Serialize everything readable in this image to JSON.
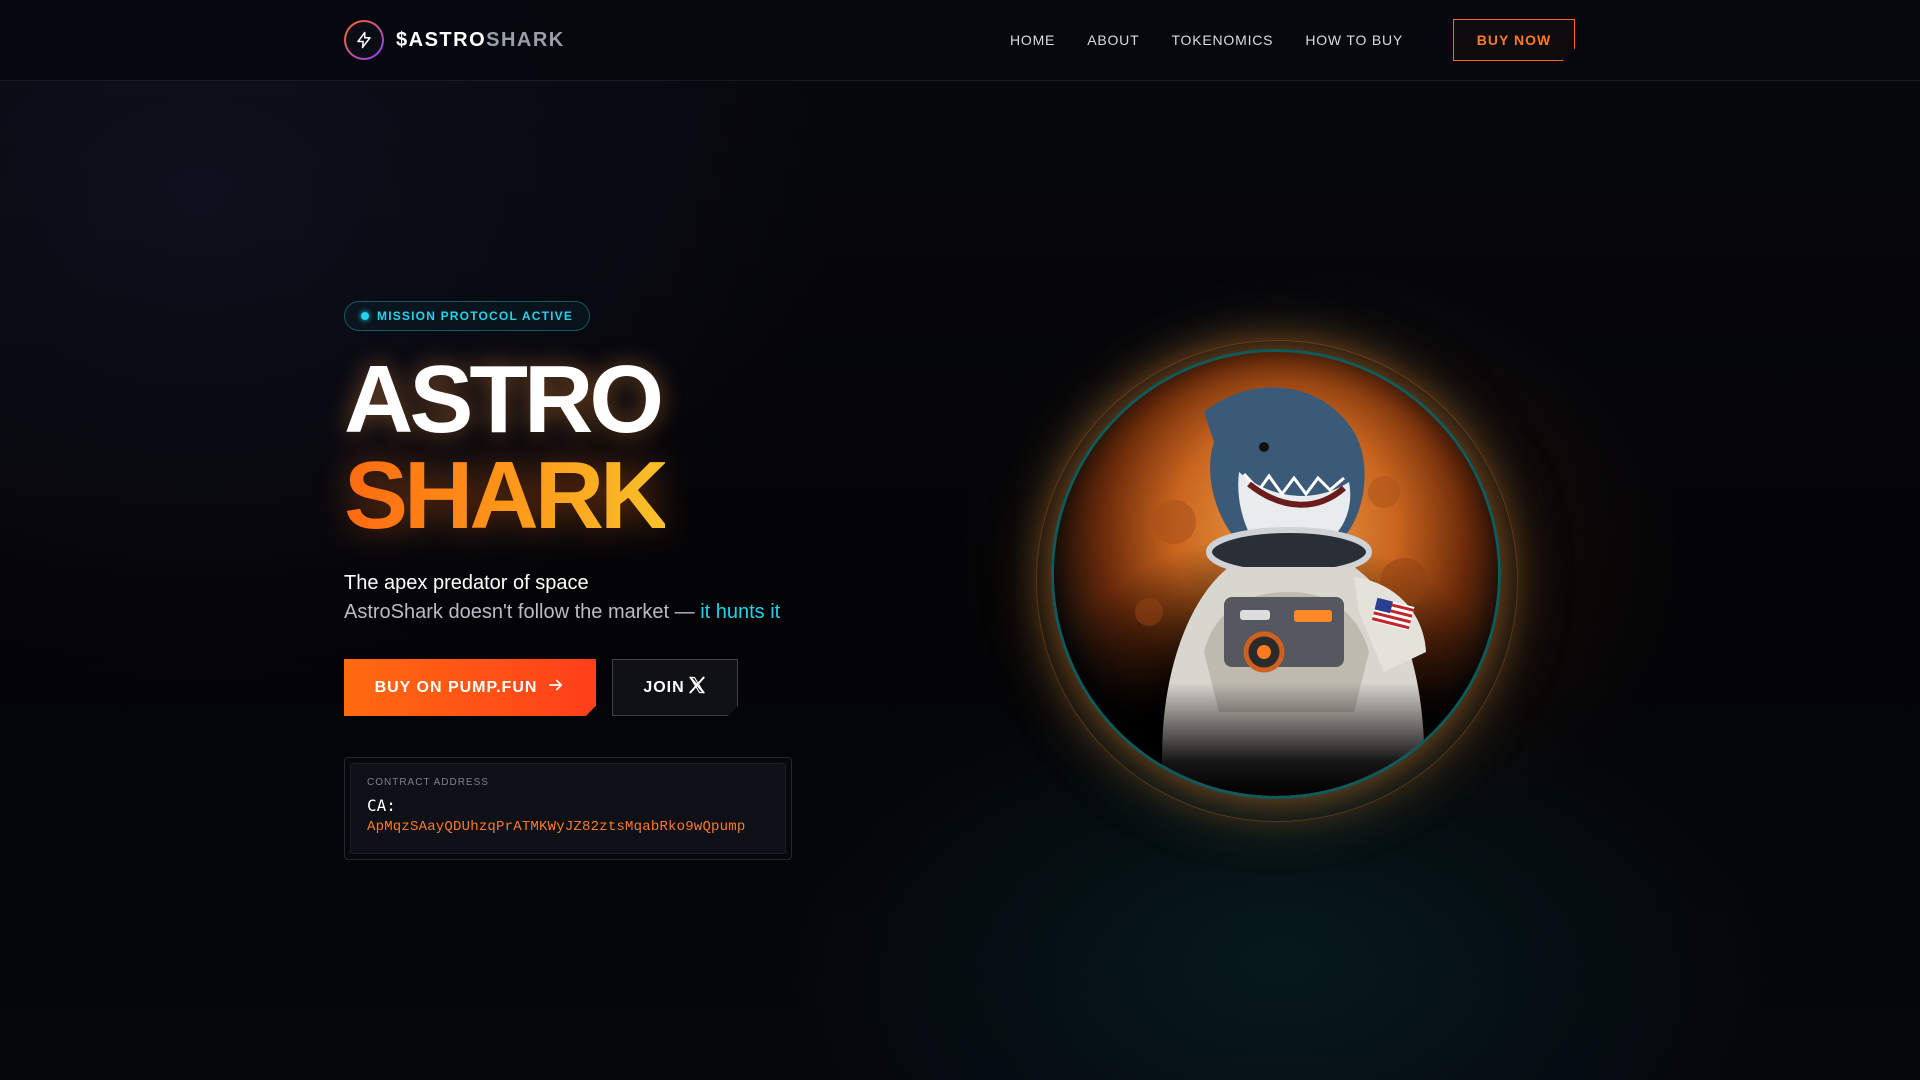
{
  "brand": {
    "ticker_primary": "$ASTRO",
    "ticker_secondary": "SHARK",
    "logo_icon": "lightning-bolt-icon"
  },
  "nav": {
    "items": [
      {
        "label": "HOME"
      },
      {
        "label": "ABOUT"
      },
      {
        "label": "TOKENOMICS"
      },
      {
        "label": "HOW TO BUY"
      }
    ],
    "cta_label": "BUY NOW"
  },
  "hero": {
    "badge": "MISSION PROTOCOL ACTIVE",
    "title_line1": "ASTRO",
    "title_line2": "SHARK",
    "tagline": "The apex predator of space",
    "subline_prefix": "AstroShark doesn't follow the market — ",
    "subline_highlight": "it hunts it",
    "primary_button": "BUY ON PUMP.FUN",
    "primary_button_icon": "arrow-right-icon",
    "secondary_button": "JOIN",
    "secondary_button_icon": "x-logo-icon"
  },
  "contract": {
    "label": "CONTRACT ADDRESS",
    "prefix": "CA:",
    "address": "ApMqzSAayQDUhzqPrATMKWyJZ82ztsMqabRko9wQpump"
  },
  "hero_image": {
    "subject": "shark-astronaut-illustration"
  },
  "colors": {
    "accent_orange": "#ff6a1a",
    "accent_cyan": "#22d3ee",
    "background": "#05060a"
  }
}
